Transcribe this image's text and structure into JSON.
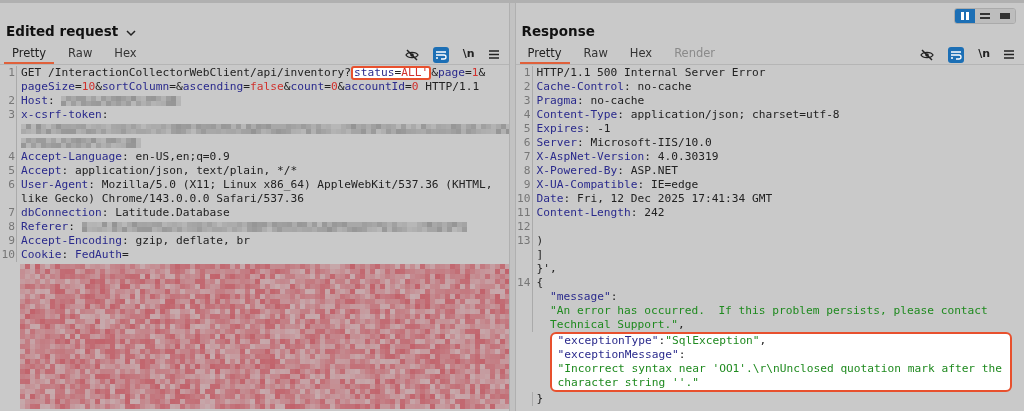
{
  "layout_buttons": [
    {
      "kind": "columns",
      "selected": true
    },
    {
      "kind": "rows",
      "selected": false
    },
    {
      "kind": "single",
      "selected": false
    }
  ],
  "panels": [
    {
      "title": "Edited request",
      "has_menu": true,
      "tabs": [
        {
          "label": "Pretty",
          "selected": true,
          "disabled": false
        },
        {
          "label": "Raw",
          "selected": false,
          "disabled": false
        },
        {
          "label": "Hex",
          "selected": false,
          "disabled": false
        }
      ],
      "newline_label": "\\n",
      "wrap_on": true,
      "lines": [
        {
          "number": "1",
          "segments": [
            {
              "kind": "plain",
              "text": "GET /InteractionCollectorWebClient/api/inventory?"
            },
            {
              "kind": "boxed",
              "segments": [
                {
                  "kind": "name",
                  "text": "status"
                },
                {
                  "kind": "plain",
                  "text": "="
                },
                {
                  "kind": "value",
                  "text": "ALL'"
                }
              ]
            },
            {
              "kind": "plain",
              "text": "&"
            },
            {
              "kind": "name",
              "text": "page"
            },
            {
              "kind": "plain",
              "text": "="
            },
            {
              "kind": "value",
              "text": "1"
            },
            {
              "kind": "plain",
              "text": "&"
            }
          ]
        },
        {
          "segments": [
            {
              "kind": "name",
              "text": "pageSize"
            },
            {
              "kind": "plain",
              "text": "="
            },
            {
              "kind": "value",
              "text": "10"
            },
            {
              "kind": "plain",
              "text": "&"
            },
            {
              "kind": "name",
              "text": "sortColumn"
            },
            {
              "kind": "plain",
              "text": "=&"
            },
            {
              "kind": "name",
              "text": "ascending"
            },
            {
              "kind": "plain",
              "text": "="
            },
            {
              "kind": "value",
              "text": "false"
            },
            {
              "kind": "plain",
              "text": "&"
            },
            {
              "kind": "name",
              "text": "count"
            },
            {
              "kind": "plain",
              "text": "="
            },
            {
              "kind": "value",
              "text": "0"
            },
            {
              "kind": "plain",
              "text": "&"
            },
            {
              "kind": "name",
              "text": "accountId"
            },
            {
              "kind": "plain",
              "text": "="
            },
            {
              "kind": "value",
              "text": "0"
            },
            {
              "kind": "plain",
              "text": " HTTP/1.1"
            }
          ]
        },
        {
          "number": "2",
          "segments": [
            {
              "kind": "name",
              "text": "Host"
            },
            {
              "kind": "plain",
              "text": ": "
            },
            {
              "kind": "redacted"
            }
          ]
        },
        {
          "number": "3",
          "segments": [
            {
              "kind": "name",
              "text": "x-csrf-token"
            },
            {
              "kind": "plain",
              "text": ":"
            }
          ]
        },
        {
          "segments": [
            {
              "kind": "redacted"
            }
          ]
        },
        {
          "segments": [
            {
              "kind": "redacted"
            }
          ]
        },
        {
          "number": "4",
          "segments": [
            {
              "kind": "name",
              "text": "Accept-Language"
            },
            {
              "kind": "plain",
              "text": ": en-US,en;q=0.9"
            }
          ]
        },
        {
          "number": "5",
          "segments": [
            {
              "kind": "name",
              "text": "Accept"
            },
            {
              "kind": "plain",
              "text": ": application/json, text/plain, */*"
            }
          ]
        },
        {
          "number": "6",
          "segments": [
            {
              "kind": "name",
              "text": "User-Agent"
            },
            {
              "kind": "plain",
              "text": ": Mozilla/5.0 (X11; Linux x86_64) AppleWebKit/537.36 (KHTML,"
            }
          ]
        },
        {
          "segments": [
            {
              "kind": "plain",
              "text": "like Gecko) Chrome/143.0.0.0 Safari/537.36"
            }
          ]
        },
        {
          "number": "7",
          "segments": [
            {
              "kind": "name",
              "text": "dbConnection"
            },
            {
              "kind": "plain",
              "text": ": Latitude.Database"
            }
          ]
        },
        {
          "number": "8",
          "segments": [
            {
              "kind": "name",
              "text": "Referer"
            },
            {
              "kind": "plain",
              "text": ": "
            },
            {
              "kind": "redacted"
            }
          ]
        },
        {
          "number": "9",
          "segments": [
            {
              "kind": "name",
              "text": "Accept-Encoding"
            },
            {
              "kind": "plain",
              "text": ": gzip, deflate, br"
            }
          ]
        },
        {
          "number": "10",
          "segments": [
            {
              "kind": "name",
              "text": "Cookie"
            },
            {
              "kind": "plain",
              "text": ": "
            },
            {
              "kind": "name",
              "text": "FedAuth"
            },
            {
              "kind": "plain",
              "text": "="
            }
          ]
        },
        {
          "kind": "redacted_block"
        }
      ]
    },
    {
      "title": "Response",
      "has_menu": false,
      "tabs": [
        {
          "label": "Pretty",
          "selected": true,
          "disabled": false
        },
        {
          "label": "Raw",
          "selected": false,
          "disabled": false
        },
        {
          "label": "Hex",
          "selected": false,
          "disabled": false
        },
        {
          "label": "Render",
          "selected": false,
          "disabled": true
        }
      ],
      "newline_label": "\\n",
      "wrap_on": true,
      "lines": [
        {
          "number": "1",
          "segments": [
            {
              "kind": "plain",
              "text": "HTTP/1.1 500 Internal Server Error"
            }
          ]
        },
        {
          "number": "2",
          "segments": [
            {
              "kind": "name",
              "text": "Cache-Control"
            },
            {
              "kind": "plain",
              "text": ": no-cache"
            }
          ]
        },
        {
          "number": "3",
          "segments": [
            {
              "kind": "name",
              "text": "Pragma"
            },
            {
              "kind": "plain",
              "text": ": no-cache"
            }
          ]
        },
        {
          "number": "4",
          "segments": [
            {
              "kind": "name",
              "text": "Content-Type"
            },
            {
              "kind": "plain",
              "text": ": application/json; charset=utf-8"
            }
          ]
        },
        {
          "number": "5",
          "segments": [
            {
              "kind": "name",
              "text": "Expires"
            },
            {
              "kind": "plain",
              "text": ": -1"
            }
          ]
        },
        {
          "number": "6",
          "segments": [
            {
              "kind": "name",
              "text": "Server"
            },
            {
              "kind": "plain",
              "text": ": Microsoft-IIS/10.0"
            }
          ]
        },
        {
          "number": "7",
          "segments": [
            {
              "kind": "name",
              "text": "X-AspNet-Version"
            },
            {
              "kind": "plain",
              "text": ": 4.0.30319"
            }
          ]
        },
        {
          "number": "8",
          "segments": [
            {
              "kind": "name",
              "text": "X-Powered-By"
            },
            {
              "kind": "plain",
              "text": ": ASP.NET"
            }
          ]
        },
        {
          "number": "9",
          "segments": [
            {
              "kind": "name",
              "text": "X-UA-Compatible"
            },
            {
              "kind": "plain",
              "text": ": IE=edge"
            }
          ]
        },
        {
          "number": "10",
          "segments": [
            {
              "kind": "name",
              "text": "Date"
            },
            {
              "kind": "plain",
              "text": ": Fri, 12 Dec 2025 17:41:34 GMT"
            }
          ]
        },
        {
          "number": "11",
          "segments": [
            {
              "kind": "name",
              "text": "Content-Length"
            },
            {
              "kind": "plain",
              "text": ": 242"
            }
          ]
        },
        {
          "number": "12"
        },
        {
          "number": "13",
          "segments": [
            {
              "kind": "plain",
              "text": ")"
            }
          ]
        },
        {
          "segments": [
            {
              "kind": "plain",
              "text": "]"
            }
          ]
        },
        {
          "segments": [
            {
              "kind": "plain",
              "text": "}',"
            }
          ]
        },
        {
          "number": "14",
          "segments": [
            {
              "kind": "plain",
              "text": "{"
            }
          ]
        },
        {
          "segments": [
            {
              "kind": "indent"
            },
            {
              "kind": "name",
              "text": "\"message\""
            },
            {
              "kind": "plain",
              "text": ":"
            }
          ]
        },
        {
          "segments": [
            {
              "kind": "indent"
            },
            {
              "kind": "string",
              "text": "\"An error has occurred.  If this problem persists, please contact"
            }
          ]
        },
        {
          "segments": [
            {
              "kind": "indent"
            },
            {
              "kind": "string",
              "text": "Technical Support.\""
            },
            {
              "kind": "plain",
              "text": ","
            }
          ]
        },
        {
          "kind": "box",
          "lines": [
            {
              "segments": [
                {
                  "kind": "name",
                  "text": "\"exceptionType\""
                },
                {
                  "kind": "plain",
                  "text": ":"
                },
                {
                  "kind": "string",
                  "text": "\"SqlException\""
                },
                {
                  "kind": "plain",
                  "text": ","
                }
              ]
            },
            {
              "segments": [
                {
                  "kind": "name",
                  "text": "\"exceptionMessage\""
                },
                {
                  "kind": "plain",
                  "text": ":"
                }
              ]
            },
            {
              "segments": [
                {
                  "kind": "string",
                  "text": "\"Incorrect syntax near 'OO1'.\\r\\nUnclosed quotation mark after the"
                }
              ]
            },
            {
              "segments": [
                {
                  "kind": "string",
                  "text": "character string ''.\""
                }
              ]
            }
          ]
        },
        {
          "segments": [
            {
              "kind": "plain",
              "text": "}"
            }
          ]
        }
      ]
    }
  ]
}
